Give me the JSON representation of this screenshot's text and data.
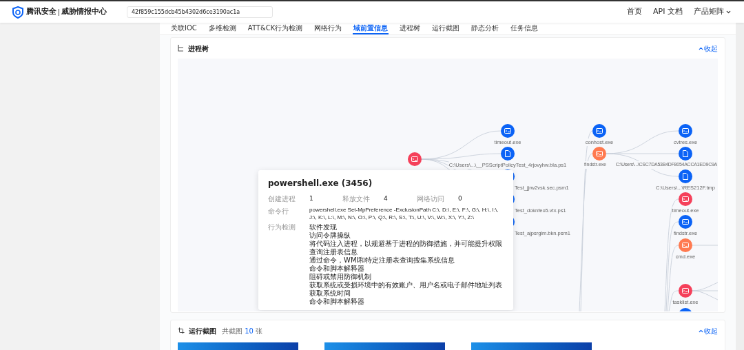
{
  "header": {
    "brand": "腾讯安全",
    "product": "威胁情报中心",
    "search": {
      "value": "42f859c155dcb45b4302d6ce3190ac1a"
    },
    "nav": [
      {
        "label": "首页",
        "kind": "link"
      },
      {
        "label": "API 文档",
        "kind": "link"
      },
      {
        "label": "产品矩阵",
        "kind": "dropdown"
      }
    ]
  },
  "tabs": [
    {
      "label": "关联IOC",
      "selected": false
    },
    {
      "label": "多维检测",
      "selected": false
    },
    {
      "label": "ATT&CK行为检测",
      "selected": false
    },
    {
      "label": "网络行为",
      "selected": false
    },
    {
      "label": "域前置信息",
      "selected": true
    },
    {
      "label": "进程树",
      "selected": false
    },
    {
      "label": "运行截图",
      "selected": false
    },
    {
      "label": "静态分析",
      "selected": false
    },
    {
      "label": "任务信息",
      "selected": false
    }
  ],
  "process_tree": {
    "title": "进程树",
    "collapse": "收起",
    "nodes": [
      {
        "label": "timeout.exe",
        "kind": "process",
        "color": "#0b63f6"
      },
      {
        "label": "C:\\Users\\...\\__PSScriptPolicyTest_4rjovyhw.bla.ps1",
        "kind": "file",
        "color": "#0b63f6"
      },
      {
        "label": "Test_jjrw2vsk.sec.psm1",
        "kind": "file",
        "color": "#0b63f6"
      },
      {
        "label": "Test_doknfeo5.vtx.ps1",
        "kind": "file",
        "color": "#0b63f6"
      },
      {
        "label": "Test_ajpsrglm.bkn.psm1",
        "kind": "file",
        "color": "#0b63f6"
      },
      {
        "kind": "process",
        "color": "#f5405a"
      },
      {
        "label": "conhost.exe",
        "kind": "process",
        "color": "#0b63f6"
      },
      {
        "label": "findstr.exe",
        "kind": "process",
        "color": "#ff7a50"
      },
      {
        "label": "cvtres.exe",
        "kind": "process",
        "color": "#0b63f6"
      },
      {
        "label": "C:\\Users\\...\\CSC7DA53B4DF8054ACCA1ED9C9A",
        "kind": "file",
        "color": "#0b63f6"
      },
      {
        "label": "C:\\Users\\...\\RES212F.tmp",
        "kind": "file",
        "color": "#0b63f6"
      },
      {
        "label": "timeout.exe",
        "kind": "process",
        "color": "#f5405a"
      },
      {
        "label": "findstr.exe",
        "kind": "process",
        "color": "#0b63f6"
      },
      {
        "label": "cmd.exe",
        "kind": "process",
        "color": "#ff7a50"
      },
      {
        "label": "tasklist.exe",
        "kind": "process",
        "color": "#f5405a"
      },
      {
        "kind": "process",
        "color": "#0b63f6"
      }
    ],
    "details": {
      "title": "powershell.exe (3456)",
      "stats": [
        {
          "label": "创建进程",
          "value": "1"
        },
        {
          "label": "释放文件",
          "value": "4"
        },
        {
          "label": "网络访问",
          "value": "0"
        }
      ],
      "command_label": "命令行",
      "command": "powershell.exe Set-MpPreference -ExclusionPath C:\\, D:\\, E:\\, F:\\, G:\\, H:\\, I:\\, J:\\, K:\\, L:\\, M:\\, N:\\, O:\\, P:\\, Q:\\, R:\\, S:\\, T:\\, U:\\, V:\\, W:\\, X:\\, Y:\\, Z:\\",
      "behavior_label": "行为检测",
      "behaviors": [
        "软件发现",
        "访问令牌操纵",
        "将代码注入进程，以规避基于进程的防御措施，并可能提升权限",
        "查询注册表信息",
        "通过命令，WMI和特定注册表查询搜集系统信息",
        "命令和脚本解释器",
        "阻碍或禁用防御机制",
        "获取系统或受损环境中的有效账户、用户名或电子邮件地址列表",
        "获取系统时间",
        "命令和脚本解释器"
      ]
    }
  },
  "screenshots": {
    "title": "运行截图",
    "count_prefix": "共截图",
    "count": "10",
    "count_suffix": "张",
    "collapse": "收起"
  }
}
